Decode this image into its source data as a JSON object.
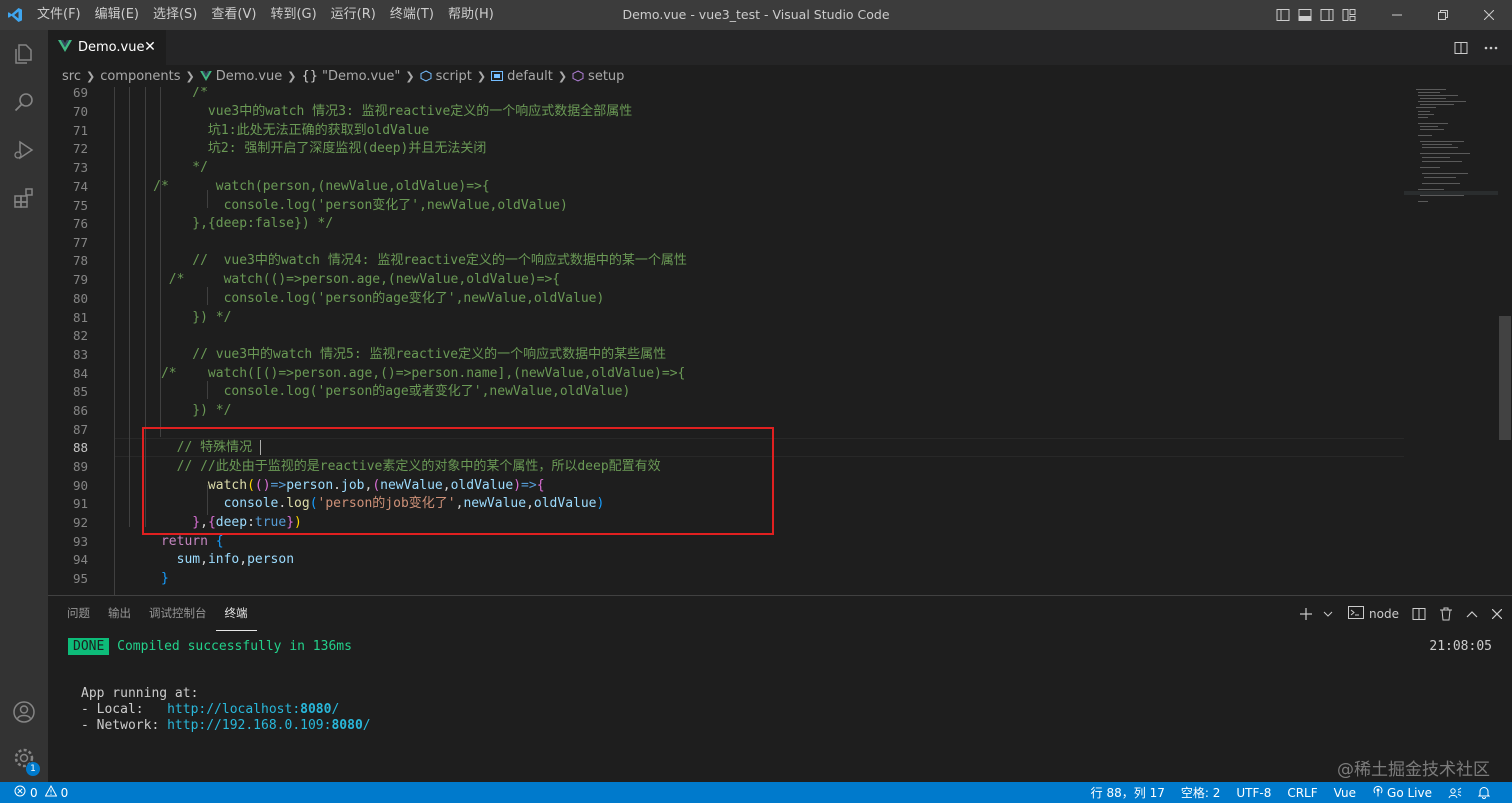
{
  "titlebar": {
    "menu": [
      "文件(F)",
      "编辑(E)",
      "选择(S)",
      "查看(V)",
      "转到(G)",
      "运行(R)",
      "终端(T)",
      "帮助(H)"
    ],
    "window_title": "Demo.vue - vue3_test - Visual Studio Code"
  },
  "tab": {
    "label": "Demo.vue"
  },
  "breadcrumbs": {
    "src": "src",
    "components": "components",
    "file": "Demo.vue",
    "module": "\"Demo.vue\"",
    "script": "script",
    "default": "default",
    "setup": "setup"
  },
  "editor": {
    "line_numbers": [
      "69",
      "70",
      "71",
      "72",
      "73",
      "74",
      "75",
      "76",
      "77",
      "78",
      "79",
      "80",
      "81",
      "82",
      "83",
      "84",
      "85",
      "86",
      "87",
      "88",
      "89",
      "90",
      "91",
      "92",
      "93",
      "94",
      "95"
    ],
    "active_line": "88"
  },
  "panel": {
    "tabs": [
      "问题",
      "输出",
      "调试控制台",
      "终端"
    ],
    "active_tab": "终端",
    "shell_label": "node",
    "terminal": {
      "done_badge": "DONE",
      "compiled": "Compiled successfully in 136ms",
      "time": "21:08:05",
      "app_running": "App running at:",
      "local_label": "- Local:   ",
      "local_url_prefix": "http://localhost:",
      "local_port": "8080",
      "local_url_suffix": "/",
      "network_label": "- Network: ",
      "network_url_prefix": "http://192.168.0.109:",
      "network_port": "8080",
      "network_url_suffix": "/"
    }
  },
  "statusbar": {
    "errors": "0",
    "warnings": "0",
    "position": "行 88，列 17",
    "spaces": "空格: 2",
    "encoding": "UTF-8",
    "eol": "CRLF",
    "language": "Vue",
    "golive": "Go Live"
  },
  "activity": {
    "badge": "1"
  },
  "watermark": "@稀土掘金技术社区",
  "colors": {
    "status_bar": "#007acc",
    "highlight_box": "#e02020",
    "done_badge": "#0dbc79"
  }
}
